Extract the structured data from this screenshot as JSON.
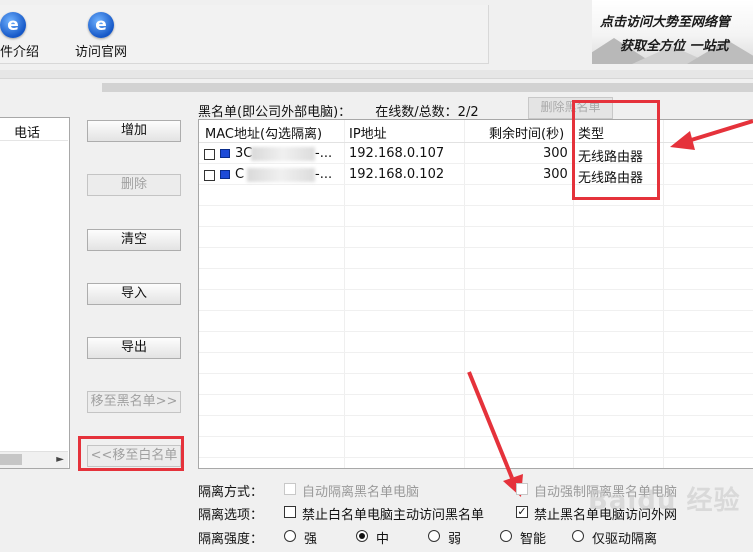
{
  "toolbar": {
    "items": [
      {
        "label": "件介绍",
        "icon": "ie-browser-icon",
        "icon_char": "e"
      },
      {
        "label": "访问官网",
        "icon": "ie-browser-icon",
        "icon_char": "e"
      }
    ]
  },
  "banner": {
    "line1": "点击访问大势至网络管",
    "line2": "获取全方位 一站式"
  },
  "left_panel": {
    "column_header": "电话"
  },
  "buttons": {
    "add": "增加",
    "delete": "删除",
    "clear": "清空",
    "import": "导入",
    "export": "导出",
    "move_to_blacklist": "移至黑名单>>",
    "move_to_whitelist": "<<移至白名单"
  },
  "blacklist": {
    "title": "黑名单(即公司外部电脑)：",
    "online_label": "在线数/总数：2/2",
    "delete_button": "删除黑名单",
    "columns": [
      "MAC地址(勾选隔离)",
      "IP地址",
      "剩余时间(秒)",
      "类型"
    ],
    "rows": [
      {
        "mac_prefix": "3C",
        "mac_suffix": "-...",
        "ip": "192.168.0.107",
        "remaining": "300",
        "type": "无线路由器"
      },
      {
        "mac_prefix": "C",
        "mac_suffix": "-...",
        "ip": "192.168.0.102",
        "remaining": "300",
        "type": "无线路由器"
      }
    ]
  },
  "options": {
    "mode_label": "隔离方式：",
    "mode_auto_blacklist": "自动隔离黑名单电脑",
    "mode_force_blacklist": "自动强制隔离黑名单电脑",
    "options_label": "隔离选项：",
    "opt_block_whitelist": "禁止白名单电脑主动访问黑名单",
    "opt_block_blacklist_internet": "禁止黑名单电脑访问外网",
    "opt_block_blacklist_internet_checked": true,
    "strength_label": "隔离强度：",
    "strength_levels": [
      "强",
      "中",
      "弱",
      "智能",
      "仅驱动隔离"
    ],
    "strength_selected": "中"
  },
  "watermark": "Baidu 经验",
  "colors": {
    "highlight_red": "#e5323b",
    "icon_blue": "#1557c7"
  }
}
